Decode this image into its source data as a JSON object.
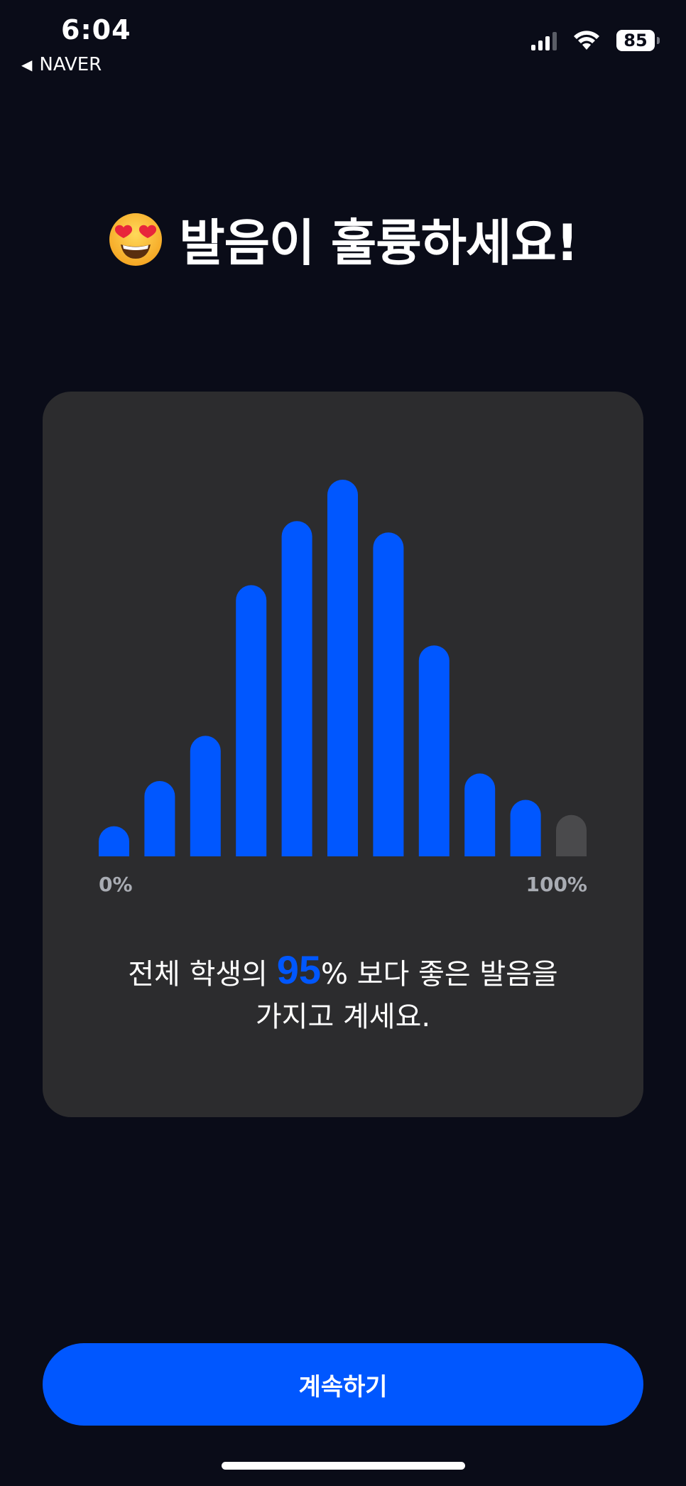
{
  "status_bar": {
    "time": "6:04",
    "back_label": "NAVER",
    "battery_level": "85",
    "signal_icon": "cellular-signal-icon",
    "wifi_icon": "wifi-icon"
  },
  "headline": {
    "emoji_icon": "heart-eyes-emoji-icon",
    "text": "발음이 훌륭하세요!"
  },
  "chart_data": {
    "type": "bar",
    "title": "",
    "xlabel": "",
    "ylabel": "",
    "x_min_label": "0%",
    "x_max_label": "100%",
    "values": [
      8,
      20,
      32,
      72,
      89,
      100,
      86,
      56,
      22,
      15,
      11
    ],
    "ylim": [
      0,
      100
    ],
    "highlight_color": "#0057ff",
    "muted_color": "#4a4a4c",
    "highlighted_count": 10
  },
  "result": {
    "prefix": "전체 학생의 ",
    "percent": "95",
    "suffix_line1": "% 보다 좋은 발음을",
    "line2": "가지고 계세요."
  },
  "continue_button": {
    "label": "계속하기"
  },
  "colors": {
    "background": "#0a0c18",
    "card": "#2c2c2e",
    "accent": "#0057ff"
  }
}
